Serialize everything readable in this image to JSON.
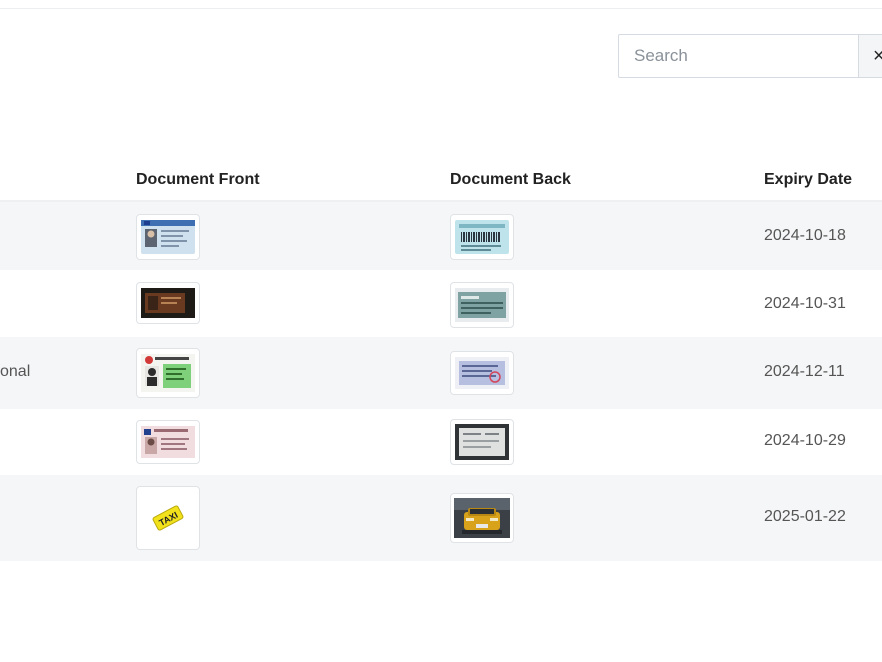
{
  "search": {
    "placeholder": "Search",
    "clear_label": "×"
  },
  "table": {
    "columns": {
      "front": "Document Front",
      "back": "Document Back",
      "expiry": "Expiry Date"
    },
    "rows": [
      {
        "partial": "",
        "front_icon": "eu-id-card-front-thumbnail",
        "back_icon": "id-card-back-barcode-thumbnail",
        "expiry": "2024-10-18"
      },
      {
        "partial": "",
        "front_icon": "dark-id-card-front-thumbnail",
        "back_icon": "id-card-back-teal-thumbnail",
        "expiry": "2024-10-31"
      },
      {
        "partial": "onal",
        "front_icon": "green-license-front-thumbnail",
        "back_icon": "license-back-stamped-thumbnail",
        "expiry": "2024-12-11"
      },
      {
        "partial": "",
        "front_icon": "pink-license-front-thumbnail",
        "back_icon": "framed-document-back-thumbnail",
        "expiry": "2024-10-29"
      },
      {
        "partial": "",
        "front_icon": "taxi-sign-thumbnail",
        "back_icon": "taxi-car-photo-thumbnail",
        "expiry": "2025-01-22"
      }
    ]
  }
}
